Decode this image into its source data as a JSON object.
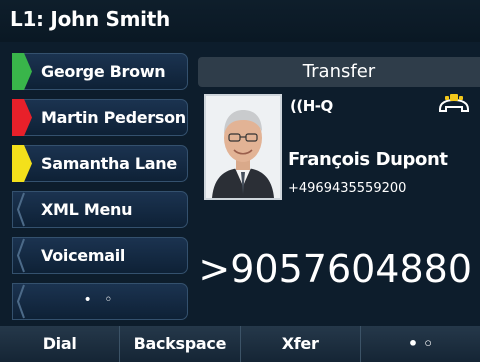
{
  "title_bar": {
    "title": "L1: John Smith"
  },
  "line_keys": [
    {
      "label": "George Brown",
      "led_color": "#39b54a"
    },
    {
      "label": "Martin Pederson",
      "led_color": "#e8202a"
    },
    {
      "label": "Samantha Lane",
      "led_color": "#f3e01b"
    },
    {
      "label": "XML Menu"
    },
    {
      "label": "Voicemail"
    },
    {
      "label": "• ◦"
    }
  ],
  "call_panel": {
    "header": "Transfer",
    "hd_badge": "((H-Q",
    "caller_name": "François Dupont",
    "caller_number": "+4969435559200",
    "dialed_number": ">9057604880",
    "icons": {
      "photo": "caller-photo",
      "state": "handset-icon"
    }
  },
  "softkeys": [
    {
      "label": "Dial"
    },
    {
      "label": "Backspace"
    },
    {
      "label": "Xfer"
    },
    {
      "label": "• ◦"
    }
  ]
}
